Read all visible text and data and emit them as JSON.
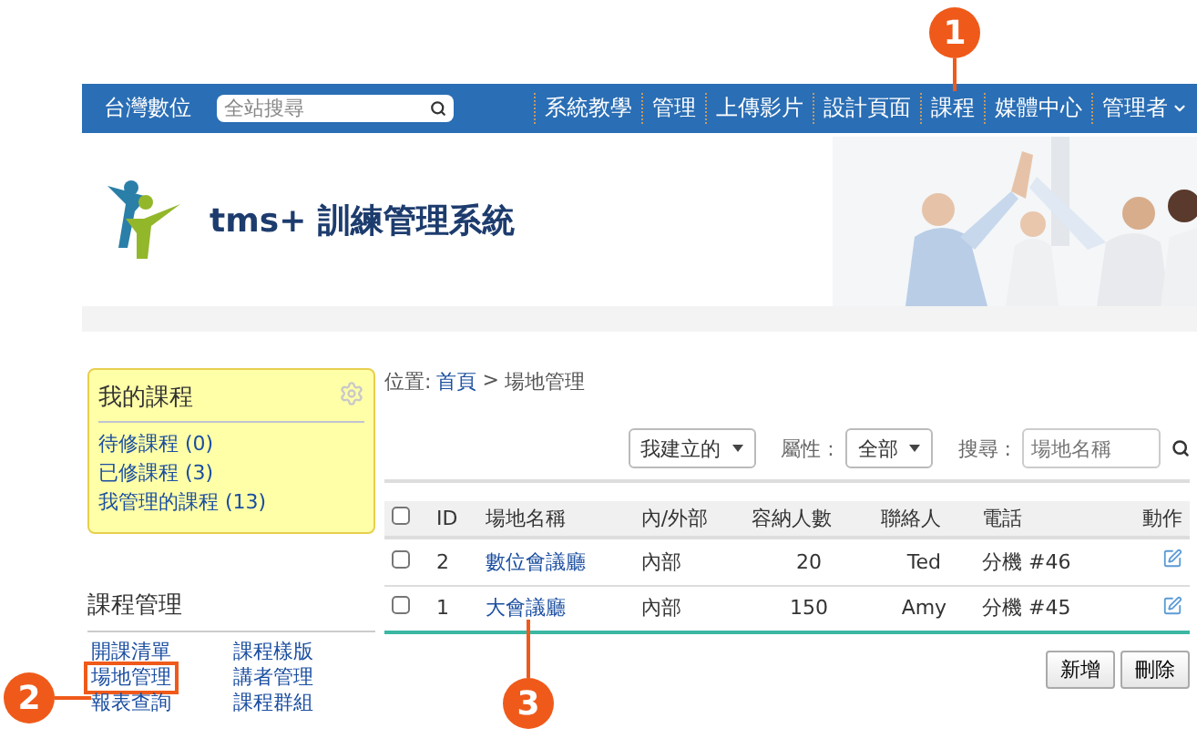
{
  "nav": {
    "brand": "台灣數位",
    "search_placeholder": "全站搜尋",
    "items": [
      {
        "label": "系統教學",
        "dropdown": false
      },
      {
        "label": "管理",
        "dropdown": false
      },
      {
        "label": "上傳影片",
        "dropdown": false
      },
      {
        "label": "設計頁面",
        "dropdown": false
      },
      {
        "label": "課程",
        "dropdown": false
      },
      {
        "label": "媒體中心",
        "dropdown": false
      },
      {
        "label": "管理者",
        "dropdown": true
      }
    ]
  },
  "header": {
    "title": "tms+ 訓練管理系統"
  },
  "my_courses": {
    "title": "我的課程",
    "links": [
      "待修課程 (0)",
      "已修課程 (3)",
      "我管理的課程 (13)"
    ]
  },
  "course_admin": {
    "title": "課程管理",
    "links": [
      {
        "label": "開課清單",
        "highlighted": false
      },
      {
        "label": "課程樣版",
        "highlighted": false
      },
      {
        "label": "場地管理",
        "highlighted": true
      },
      {
        "label": "講者管理",
        "highlighted": false
      },
      {
        "label": "報表查詢",
        "highlighted": false
      },
      {
        "label": "課程群組",
        "highlighted": false
      }
    ]
  },
  "breadcrumb": {
    "prefix": "位置:",
    "home": "首頁",
    "separator": ">",
    "current": "場地管理"
  },
  "filters": {
    "owner": "我建立的",
    "attr_label": "屬性 :",
    "attr": "全部",
    "search_label": "搜尋 :",
    "search_placeholder": "場地名稱"
  },
  "table": {
    "select_all": false,
    "columns": [
      "ID",
      "場地名稱",
      "內/外部",
      "容納人數",
      "聯絡人",
      "電話",
      "動作"
    ],
    "rows": [
      {
        "checked": false,
        "id": "2",
        "name": "數位會議廳",
        "type": "內部",
        "capacity": "20",
        "contact": "Ted",
        "phone": "分機 #46"
      },
      {
        "checked": false,
        "id": "1",
        "name": "大會議廳",
        "type": "內部",
        "capacity": "150",
        "contact": "Amy",
        "phone": "分機 #45"
      }
    ]
  },
  "buttons": [
    "新增",
    "刪除"
  ],
  "callouts": [
    {
      "number": "1"
    },
    {
      "number": "2"
    },
    {
      "number": "3"
    }
  ]
}
